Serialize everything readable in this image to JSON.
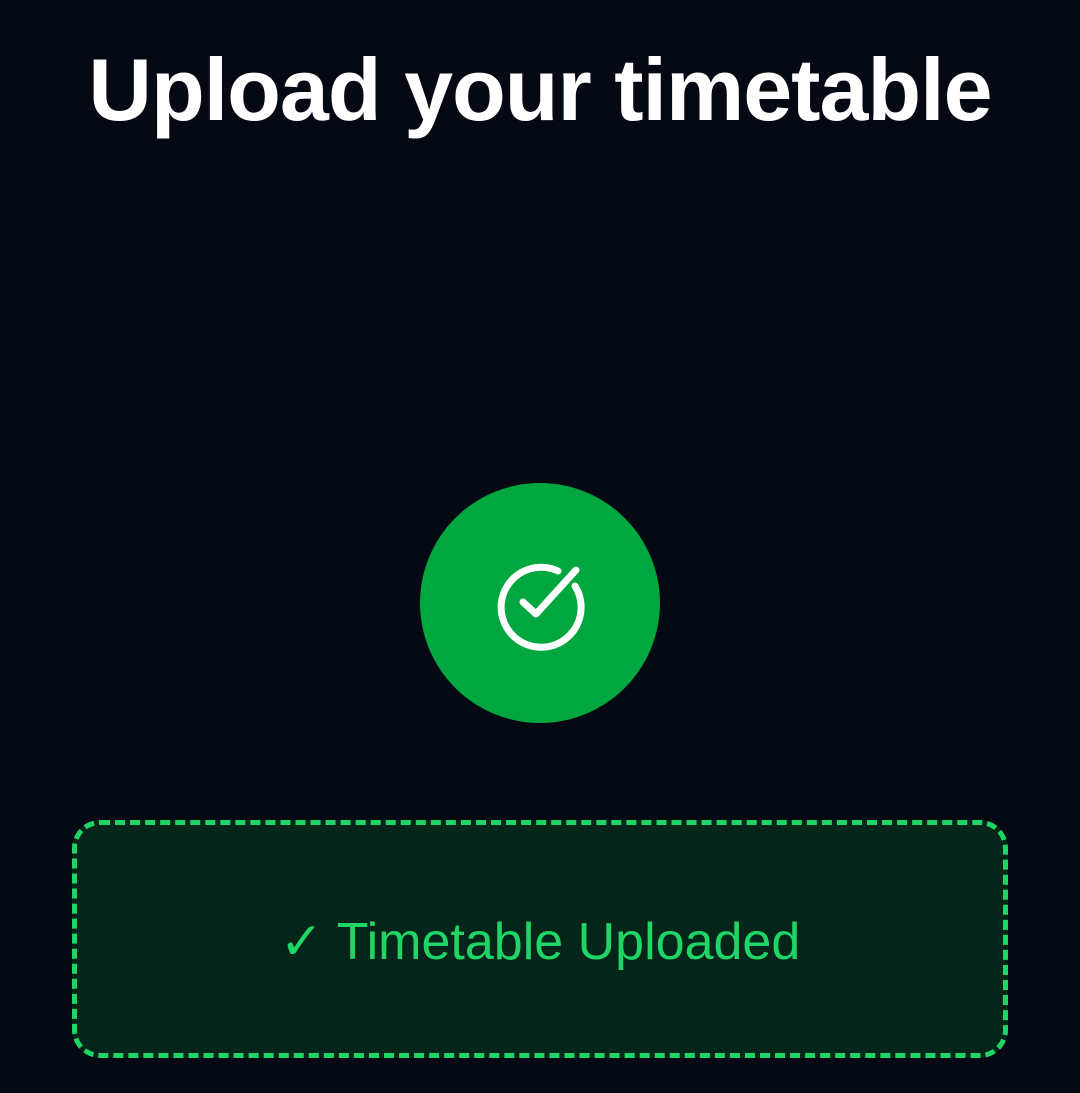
{
  "header": {
    "title": "Upload your timetable"
  },
  "status_icon": {
    "name": "circle-check-icon",
    "background_color": "#00a63e",
    "icon_color": "#ffffff"
  },
  "upload_zone": {
    "status_text": "✓ Timetable Uploaded",
    "border_color": "#1fd566",
    "background_color": "#03251a",
    "text_color": "#1fd566"
  },
  "colors": {
    "page_background": "#050914",
    "title_text": "#ffffff"
  }
}
